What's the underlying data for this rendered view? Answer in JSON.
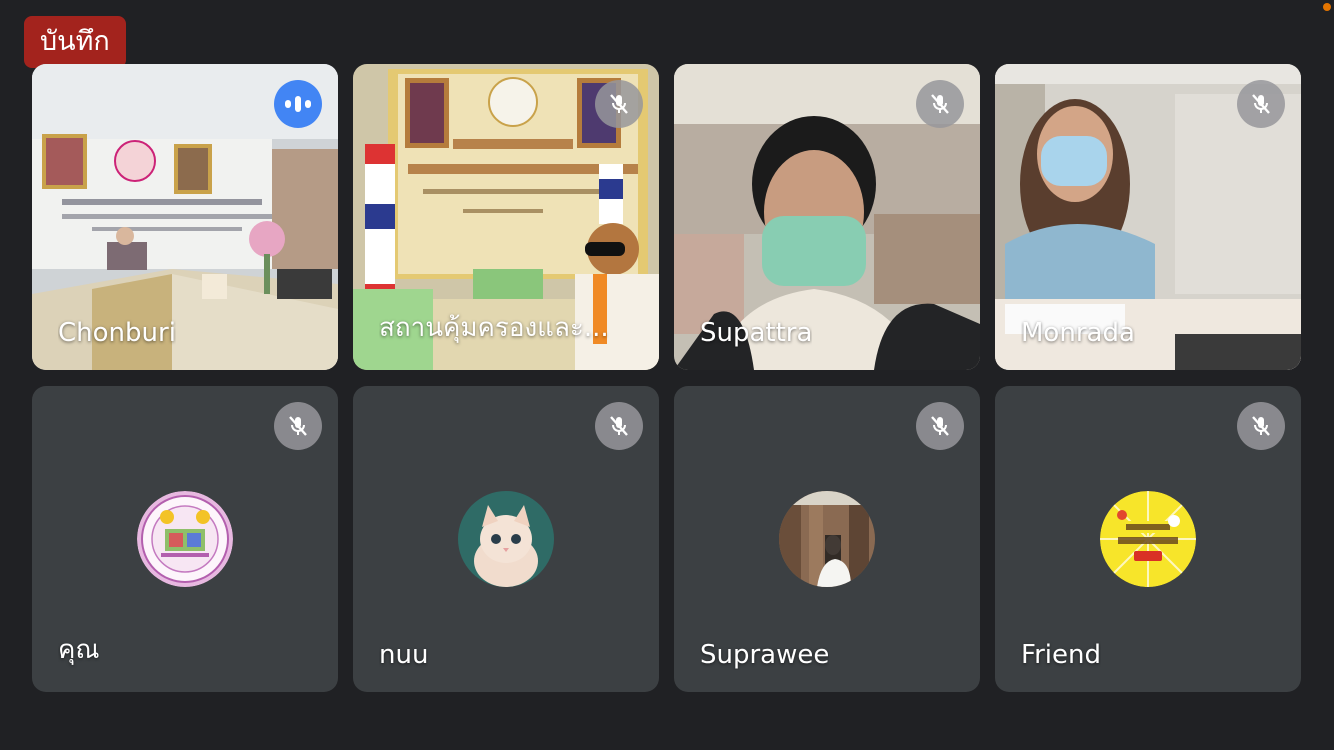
{
  "recording_label": "บันทึก",
  "participants": [
    {
      "name": "Chonburi",
      "mic": "speaking"
    },
    {
      "name": "สถานคุ้มครองและ...",
      "mic": "muted"
    },
    {
      "name": "Supattra",
      "mic": "muted"
    },
    {
      "name": "Monrada",
      "mic": "muted"
    },
    {
      "name": "คุณ",
      "mic": "muted"
    },
    {
      "name": "nuu",
      "mic": "muted"
    },
    {
      "name": "Suprawee",
      "mic": "muted"
    },
    {
      "name": "Friend",
      "mic": "muted"
    }
  ],
  "colors": {
    "background": "#202124",
    "tile": "#3c4043",
    "recording": "#a3231d",
    "speaking": "#4285f4"
  }
}
